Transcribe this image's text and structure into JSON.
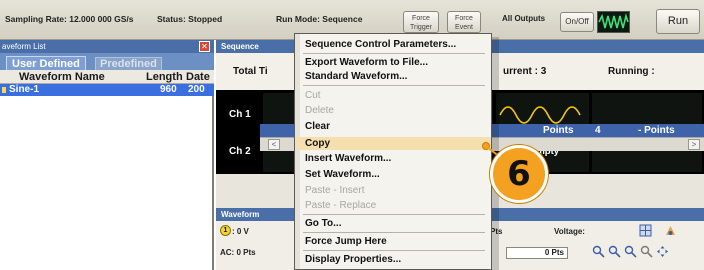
{
  "topbar": {
    "sampling_rate": "Sampling Rate: 12.000 000 GS/s",
    "status": "Status: Stopped",
    "run_mode": "Run Mode: Sequence",
    "force_trigger_line1": "Force",
    "force_trigger_line2": "Trigger",
    "force_event_line1": "Force",
    "force_event_line2": "Event",
    "all_outputs": "All Outputs",
    "onoff": "On/Off",
    "run": "Run",
    "wave_icon": "waveform-icon"
  },
  "waveform_list": {
    "title": "aveform List",
    "close": "✕",
    "tabs": [
      "User Defined",
      "Predefined"
    ],
    "columns": [
      "Waveform Name",
      "Length",
      "Date"
    ],
    "rows": [
      {
        "name": "Sine-1",
        "length": "960",
        "date": "200"
      }
    ]
  },
  "sequence": {
    "title": "Sequence",
    "total_label": "Total Ti",
    "current_label": "urrent : 3",
    "running_label": "Running :",
    "channels": [
      "Ch 1",
      "Ch 2"
    ],
    "empty": "Empty",
    "points": [
      "Points",
      "4",
      "- Points"
    ],
    "scroll_left": "<",
    "scroll_right": ">"
  },
  "waveform_panel": {
    "title": "Waveform",
    "marker": "1",
    "marker_value": ": 0 V",
    "ac_label": "AC: 0 Pts",
    "pts_label": "Pts",
    "voltage_label": "Voltage:",
    "pts_value": "0 Pts"
  },
  "context_menu": {
    "items": [
      {
        "label": "Sequence Control Parameters...",
        "enabled": true
      },
      {
        "label": "Export Waveform to File...",
        "enabled": true
      },
      {
        "label": "Standard Waveform...",
        "enabled": true
      },
      {
        "label": "Cut",
        "enabled": false
      },
      {
        "label": "Delete",
        "enabled": false
      },
      {
        "label": "Clear",
        "enabled": true
      },
      {
        "label": "Copy",
        "enabled": true,
        "highlighted": true
      },
      {
        "label": "Insert Waveform...",
        "enabled": true
      },
      {
        "label": "Set Waveform...",
        "enabled": true
      },
      {
        "label": "Paste - Insert",
        "enabled": false
      },
      {
        "label": "Paste - Replace",
        "enabled": false
      },
      {
        "label": "Go To...",
        "enabled": true
      },
      {
        "label": "Force Jump Here",
        "enabled": true
      },
      {
        "label": "Display Properties...",
        "enabled": true
      }
    ]
  },
  "callout": {
    "number": "6"
  },
  "colors": {
    "title_bar": "#4a6ea8",
    "selection": "#3b6fe0",
    "menu_highlight": "#f6dfae",
    "callout": "#f4a020",
    "wave": "#f0c419",
    "wave_icon": "#3fe07a"
  }
}
